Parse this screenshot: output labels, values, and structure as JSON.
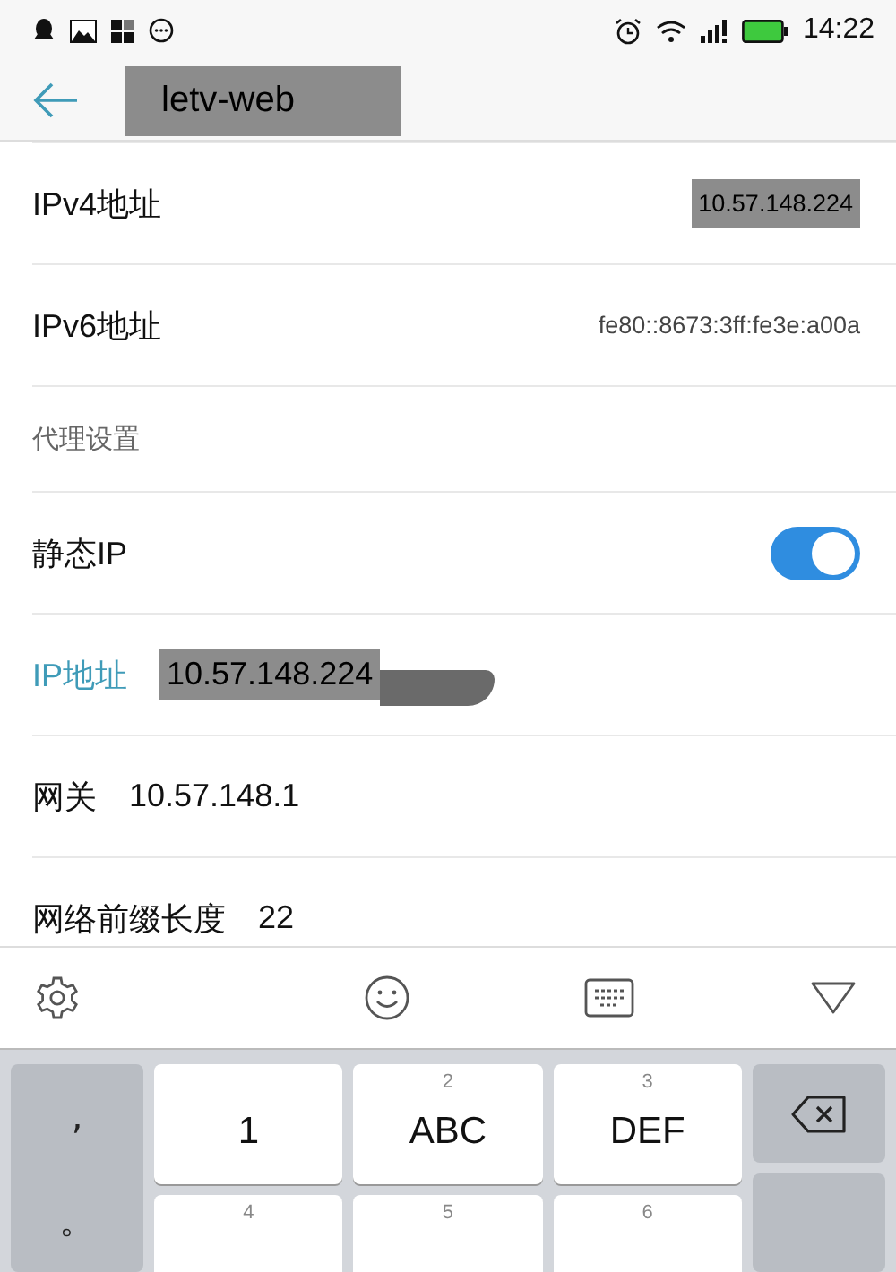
{
  "status_bar": {
    "time": "14:22"
  },
  "header": {
    "title": "letv-web",
    "redacted": true
  },
  "rows": [
    {
      "kind": "value",
      "label": "IPv4地址",
      "value": "10.57.148.224",
      "redacted": true
    },
    {
      "kind": "value",
      "label": "IPv6地址",
      "value": "fe80::8673:3ff:fe3e:a00a"
    },
    {
      "kind": "section",
      "label": "代理设置"
    },
    {
      "kind": "toggle",
      "label": "静态IP",
      "on": true
    },
    {
      "kind": "field",
      "label": "IP地址",
      "value": "10.57.148.224",
      "focused": true,
      "redacted": true
    },
    {
      "kind": "field",
      "label": "网关",
      "value": "10.57.148.1",
      "focused": false
    },
    {
      "kind": "field",
      "label": "网络前缀长度",
      "value": "22",
      "focused": false
    }
  ],
  "keyboard": {
    "punctuation": [
      ",",
      "。"
    ],
    "keys": [
      {
        "label": "1"
      },
      {
        "digit": "2",
        "label": "ABC"
      },
      {
        "digit": "3",
        "label": "DEF"
      },
      {
        "digit": "4"
      },
      {
        "digit": "5"
      },
      {
        "digit": "6"
      }
    ]
  }
}
